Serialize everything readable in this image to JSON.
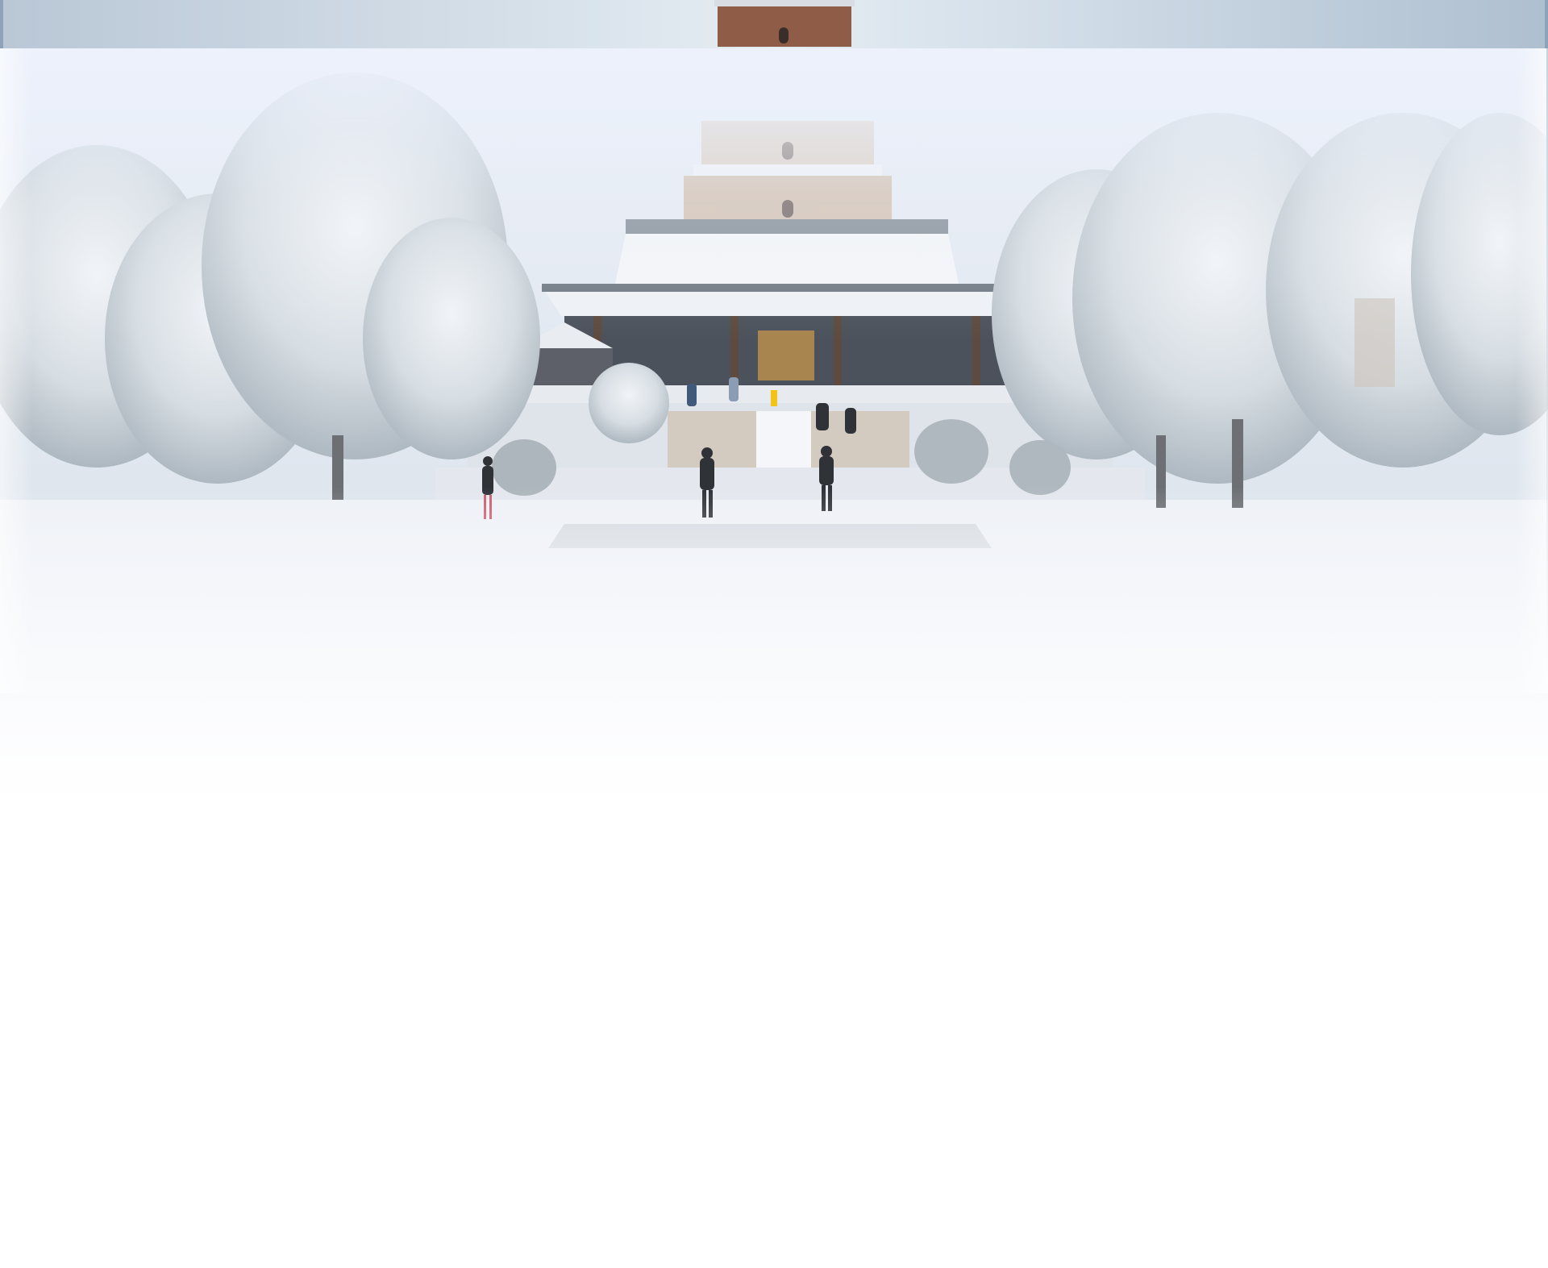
{
  "scene": {
    "description_colors": {
      "sky": "#e8eef6",
      "snow": "#f4f6fa",
      "tree_snow": "#e3e8ee",
      "tree_dark": "#9aa4ad",
      "hall_wood": "#4a4f58",
      "pagoda_brick": "#8a5a45",
      "top_bar": "#c7d4e0"
    }
  }
}
